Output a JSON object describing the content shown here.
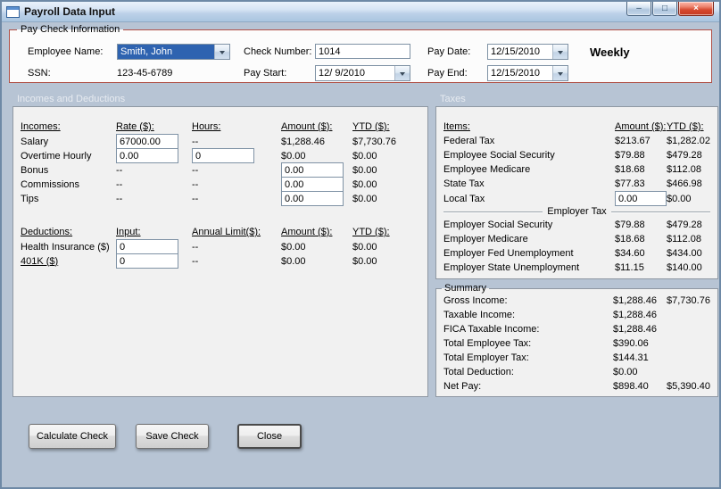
{
  "window": {
    "title": "Payroll Data Input",
    "controls": {
      "minimize": "–",
      "maximize": "□",
      "close": "×"
    }
  },
  "paycheck": {
    "group_label": "Pay Check Information",
    "employee_name_label": "Employee Name:",
    "employee_name_value": "Smith, John",
    "ssn_label": "SSN:",
    "ssn_value": "123-45-6789",
    "check_number_label": "Check Number:",
    "check_number_value": "1014",
    "pay_start_label": "Pay Start:",
    "pay_start_value": "12/ 9/2010",
    "pay_date_label": "Pay Date:",
    "pay_date_value": "12/15/2010",
    "pay_end_label": "Pay End:",
    "pay_end_value": "12/15/2010",
    "frequency": "Weekly"
  },
  "sections": {
    "incomes_header": "Incomes and Deductions",
    "taxes_header": "Taxes"
  },
  "incomes": {
    "headers": {
      "item": "Incomes:",
      "rate": "Rate ($):",
      "hours": "Hours:",
      "amount": "Amount ($):",
      "ytd": "YTD ($):"
    },
    "rows": [
      {
        "label": "Salary",
        "rate": "67000.00",
        "hours": "--",
        "amount": "$1,288.46",
        "ytd": "$7,730.76"
      },
      {
        "label": "Overtime Hourly",
        "rate": "0.00",
        "hours": "0",
        "amount": "$0.00",
        "ytd": "$0.00"
      },
      {
        "label": "Bonus",
        "rate": "--",
        "hours": "--",
        "amount": "0.00",
        "ytd": "$0.00"
      },
      {
        "label": "Commissions",
        "rate": "--",
        "hours": "--",
        "amount": "0.00",
        "ytd": "$0.00"
      },
      {
        "label": "Tips",
        "rate": "--",
        "hours": "--",
        "amount": "0.00",
        "ytd": "$0.00"
      }
    ]
  },
  "deductions": {
    "headers": {
      "item": "Deductions:",
      "input": "Input:",
      "limit": "Annual Limit($):",
      "amount": "Amount ($):",
      "ytd": "YTD ($):"
    },
    "rows": [
      {
        "label": "Health Insurance ($)",
        "input": "0",
        "limit": "--",
        "amount": "$0.00",
        "ytd": "$0.00"
      },
      {
        "label": "401K ($)",
        "input": "0",
        "limit": "--",
        "amount": "$0.00",
        "ytd": "$0.00"
      }
    ]
  },
  "taxes": {
    "headers": {
      "item": "Items:",
      "amount": "Amount ($):",
      "ytd": "YTD ($):"
    },
    "employee_rows": [
      {
        "label": "Federal Tax",
        "amount": "$213.67",
        "ytd": "$1,282.02"
      },
      {
        "label": "Employee Social Security",
        "amount": "$79.88",
        "ytd": "$479.28"
      },
      {
        "label": "Employee Medicare",
        "amount": "$18.68",
        "ytd": "$112.08"
      },
      {
        "label": "State Tax",
        "amount": "$77.83",
        "ytd": "$466.98"
      },
      {
        "label": "Local Tax",
        "amount": "0.00",
        "ytd": "$0.00"
      }
    ],
    "employer_divider": "Employer Tax",
    "employer_rows": [
      {
        "label": "Employer Social Security",
        "amount": "$79.88",
        "ytd": "$479.28"
      },
      {
        "label": "Employer Medicare",
        "amount": "$18.68",
        "ytd": "$112.08"
      },
      {
        "label": "Employer Fed Unemployment",
        "amount": "$34.60",
        "ytd": "$434.00"
      },
      {
        "label": "Employer State Unemployment",
        "amount": "$11.15",
        "ytd": "$140.00"
      }
    ]
  },
  "summary": {
    "group_label": "Summary",
    "rows": [
      {
        "label": "Gross Income:",
        "amount": "$1,288.46",
        "ytd": "$7,730.76"
      },
      {
        "label": "Taxable Income:",
        "amount": "$1,288.46",
        "ytd": ""
      },
      {
        "label": "FICA Taxable Income:",
        "amount": "$1,288.46",
        "ytd": ""
      },
      {
        "label": "Total Employee Tax:",
        "amount": "$390.06",
        "ytd": ""
      },
      {
        "label": "Total Employer Tax:",
        "amount": "$144.31",
        "ytd": ""
      },
      {
        "label": "Total Deduction:",
        "amount": "$0.00",
        "ytd": ""
      },
      {
        "label": "Net Pay:",
        "amount": "$898.40",
        "ytd": "$5,390.40"
      }
    ]
  },
  "buttons": {
    "calculate": "Calculate Check",
    "save": "Save Check",
    "close": "Close"
  },
  "colors": {
    "form_background": "#b7c4d4",
    "panel_background": "#f1f1f1",
    "paycheck_border_red": "#b05046",
    "selection_blue": "#2e63b0",
    "close_button_red": "#c9432c"
  }
}
